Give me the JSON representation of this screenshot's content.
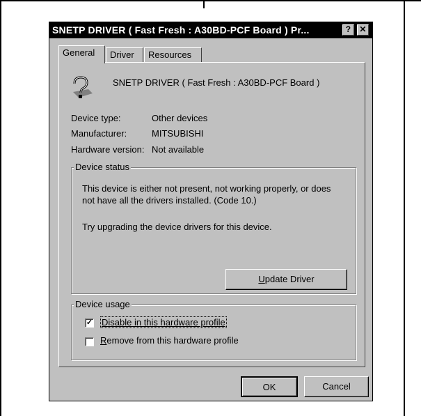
{
  "window": {
    "title": "SNETP DRIVER ( Fast Fresh : A30BD-PCF Board ) Pr...",
    "help_glyph": "?",
    "close_glyph": "✕"
  },
  "tabs": [
    {
      "label": "General",
      "active": true
    },
    {
      "label": "Driver",
      "active": false
    },
    {
      "label": "Resources",
      "active": false
    }
  ],
  "device": {
    "name": "SNETP DRIVER ( Fast Fresh : A30BD-PCF Board )",
    "icon": "unknown-device-icon",
    "properties": [
      {
        "label": "Device type:",
        "value": "Other devices"
      },
      {
        "label": "Manufacturer:",
        "value": "MITSUBISHI"
      },
      {
        "label": "Hardware version:",
        "value": "Not available"
      }
    ]
  },
  "status": {
    "title": "Device status",
    "message": "This device is either not present, not working properly, or does not have all the drivers installed.  (Code 10.)",
    "tip": "Try upgrading the device drivers for this device.",
    "update_pre": "",
    "update_key": "U",
    "update_post": "pdate Driver"
  },
  "usage": {
    "title": "Device usage",
    "options": [
      {
        "label": "Disable in this hardware profile",
        "checked": true,
        "checkmark": "✓"
      },
      {
        "label_key": "R",
        "label_rest": "emove from this hardware profile",
        "checked": false
      }
    ]
  },
  "buttons": {
    "ok": "OK",
    "cancel": "Cancel"
  }
}
